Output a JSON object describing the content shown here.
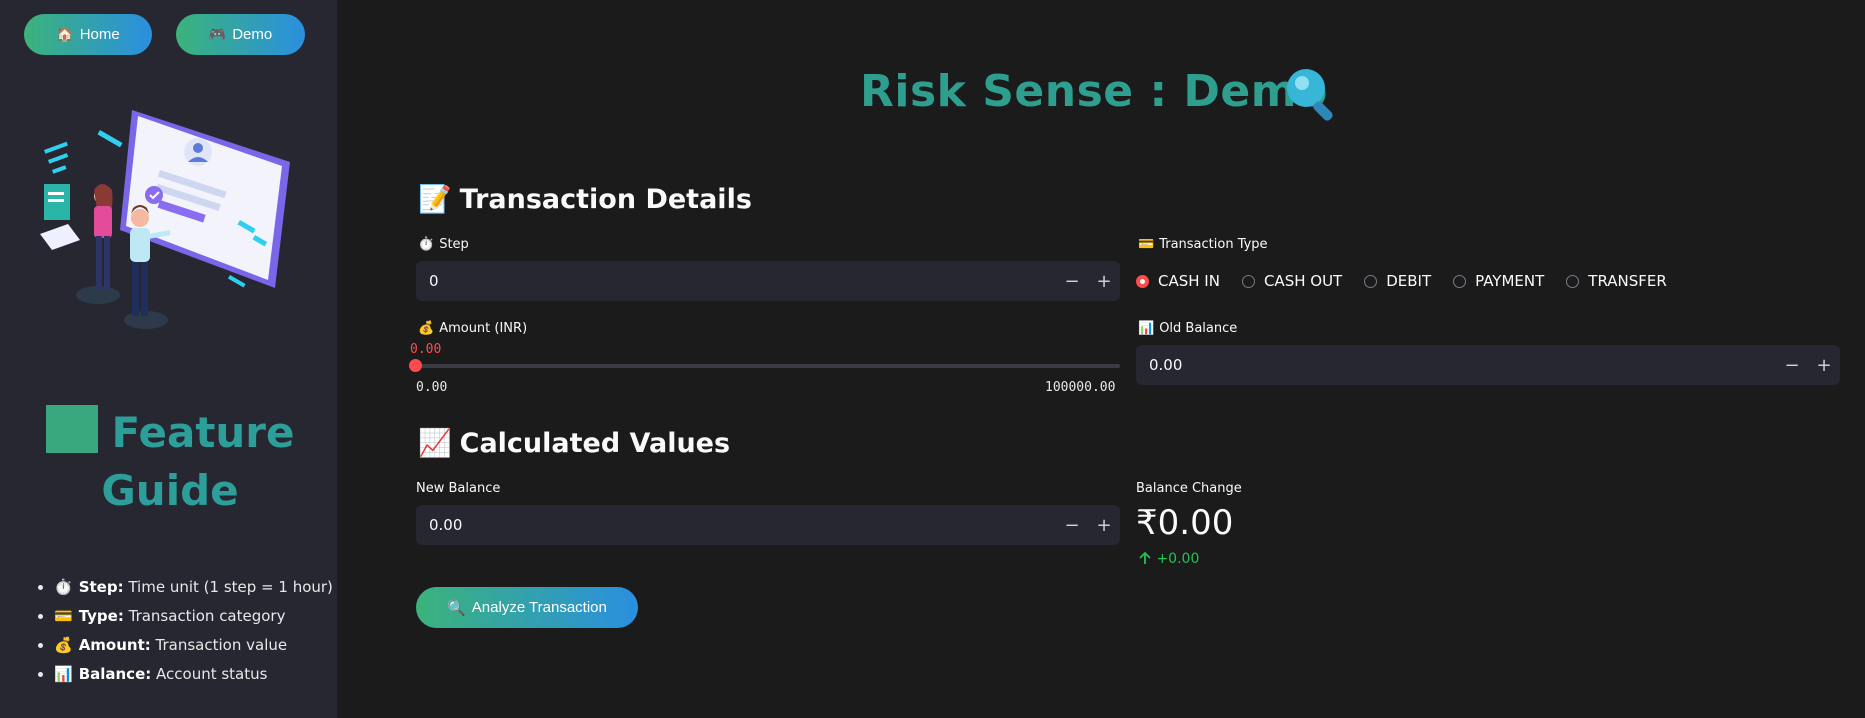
{
  "nav": {
    "home": {
      "icon": "🏠",
      "label": "Home"
    },
    "demo": {
      "icon": "🎮",
      "label": "Demo"
    }
  },
  "sidebar": {
    "title": "Feature Guide",
    "items": [
      {
        "icon": "⏱️",
        "term": "Step:",
        "desc": "Time unit (1 step = 1 hour)"
      },
      {
        "icon": "💳",
        "term": "Type:",
        "desc": "Transaction category"
      },
      {
        "icon": "💰",
        "term": "Amount:",
        "desc": "Transaction value"
      },
      {
        "icon": "📊",
        "term": "Balance:",
        "desc": "Account status"
      }
    ]
  },
  "page": {
    "title": "Risk Sense : Demo"
  },
  "transaction": {
    "heading_icon": "📝",
    "heading": "Transaction Details",
    "step": {
      "icon": "⏱️",
      "label": "Step",
      "value": "0"
    },
    "type": {
      "icon": "💳",
      "label": "Transaction Type",
      "options": [
        "CASH IN",
        "CASH OUT",
        "DEBIT",
        "PAYMENT",
        "TRANSFER"
      ],
      "selected": "CASH IN"
    },
    "amount": {
      "icon": "💰",
      "label": "Amount (INR)",
      "value": "0.00",
      "min": "0.00",
      "max": "100000.00",
      "fraction": 0
    },
    "old_balance": {
      "icon": "📊",
      "label": "Old Balance",
      "value": "0.00"
    }
  },
  "calculated": {
    "heading_icon": "📈",
    "heading": "Calculated Values",
    "new_balance": {
      "label": "New Balance",
      "value": "0.00"
    },
    "balance_change": {
      "label": "Balance Change",
      "value": "₹0.00",
      "delta": "+0.00"
    }
  },
  "actions": {
    "analyze": {
      "icon": "🔍",
      "label": "Analyze Transaction"
    }
  },
  "steppers": {
    "minus": "−",
    "plus": "+"
  },
  "colors": {
    "accent": "#ff4b4b",
    "gradient_start": "#3bb37a",
    "gradient_end": "#2a8fe0",
    "title": "#2e9e8e",
    "positive": "#21c354"
  }
}
